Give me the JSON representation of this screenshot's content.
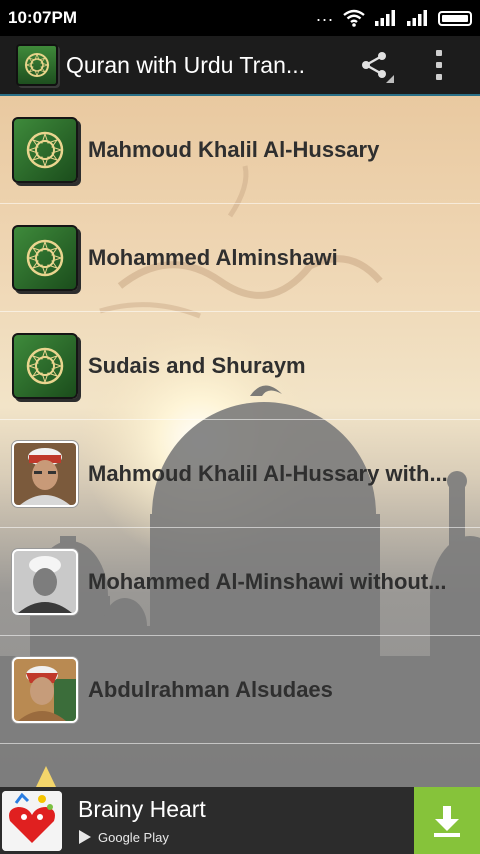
{
  "status_bar": {
    "time": "10:07PM",
    "more": "..."
  },
  "action_bar": {
    "title": "Quran with Urdu Tran..."
  },
  "list": [
    {
      "label": "Mahmoud Khalil Al-Hussary",
      "thumb": "quran-book-icon"
    },
    {
      "label": "Mohammed Alminshawi",
      "thumb": "quran-book-icon"
    },
    {
      "label": "Sudais and Shuraym",
      "thumb": "quran-book-icon"
    },
    {
      "label": "Mahmoud Khalil Al-Hussary with...",
      "thumb": "reciter-portrait"
    },
    {
      "label": "Mohammed Al-Minshawi without...",
      "thumb": "reciter-portrait"
    },
    {
      "label": "Abdulrahman Alsudaes",
      "thumb": "reciter-portrait"
    }
  ],
  "ad": {
    "title": "Brainy Heart",
    "store": "Google Play"
  },
  "colors": {
    "action_bar_divider": "#2a6f86",
    "download_button": "#86c33a",
    "book_green": "#3e8a3b"
  }
}
